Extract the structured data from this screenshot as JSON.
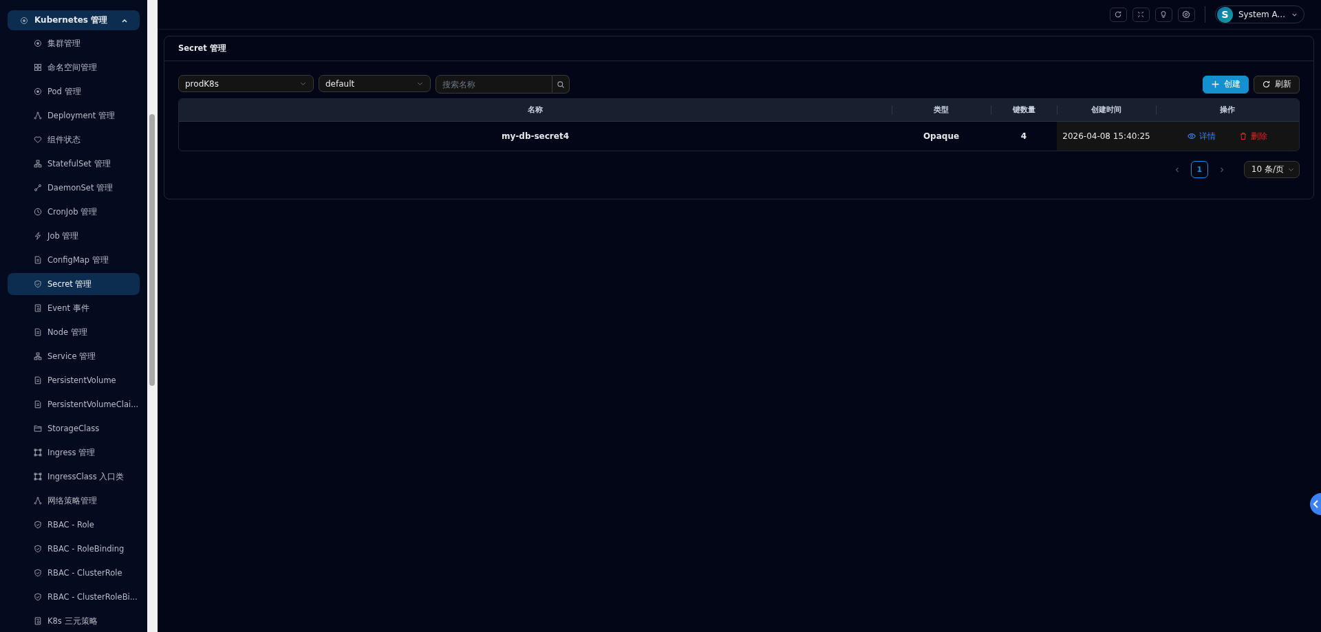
{
  "sidebar": {
    "group": {
      "label": "Kubernetes 管理",
      "expanded": true,
      "selected": true
    },
    "items": [
      {
        "label": "集群管理",
        "selected": false
      },
      {
        "label": "命名空间管理",
        "selected": false
      },
      {
        "label": "Pod 管理",
        "selected": false
      },
      {
        "label": "Deployment 管理",
        "selected": false
      },
      {
        "label": "组件状态",
        "selected": false
      },
      {
        "label": "StatefulSet 管理",
        "selected": false
      },
      {
        "label": "DaemonSet 管理",
        "selected": false
      },
      {
        "label": "CronJob 管理",
        "selected": false
      },
      {
        "label": "Job 管理",
        "selected": false
      },
      {
        "label": "ConfigMap 管理",
        "selected": false
      },
      {
        "label": "Secret 管理",
        "selected": true
      },
      {
        "label": "Event 事件",
        "selected": false
      },
      {
        "label": "Node 管理",
        "selected": false
      },
      {
        "label": "Service 管理",
        "selected": false
      },
      {
        "label": "PersistentVolume",
        "selected": false
      },
      {
        "label": "PersistentVolumeClai...",
        "selected": false
      },
      {
        "label": "StorageClass",
        "selected": false
      },
      {
        "label": "Ingress 管理",
        "selected": false
      },
      {
        "label": "IngressClass 入口类",
        "selected": false
      },
      {
        "label": "网络策略管理",
        "selected": false
      },
      {
        "label": "RBAC - Role",
        "selected": false
      },
      {
        "label": "RBAC - RoleBinding",
        "selected": false
      },
      {
        "label": "RBAC - ClusterRole",
        "selected": false
      },
      {
        "label": "RBAC - ClusterRoleBi...",
        "selected": false
      },
      {
        "label": "K8s 三元策略",
        "selected": false
      }
    ]
  },
  "header": {
    "user": {
      "avatar": "S",
      "name": "System A..."
    }
  },
  "card": {
    "title": "Secret 管理",
    "filters": {
      "cluster": "prodK8s",
      "namespace": "default",
      "search_placeholder": "搜索名称"
    },
    "actions": [
      "创建",
      "刷新"
    ],
    "table": {
      "columns": [
        "名称",
        "类型",
        "键数量",
        "创建时间",
        "操作"
      ],
      "rows": [
        {
          "name": "my-db-secret4",
          "type": "Opaque",
          "keys": "4",
          "created": "2026-04-08 15:40:25",
          "actions": [
            "详情",
            "删除"
          ]
        }
      ]
    },
    "pagination": {
      "pages": [
        {
          "label": "1",
          "selected": true
        }
      ],
      "page_size": "10 条/页"
    }
  }
}
